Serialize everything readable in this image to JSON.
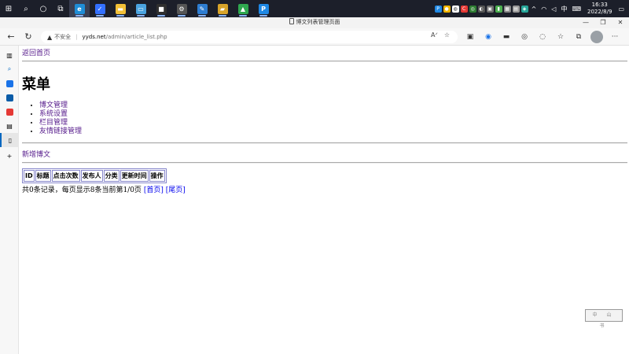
{
  "taskbar": {
    "apps": [
      {
        "name": "edge",
        "color": "#1f8dd6",
        "glyph": "e",
        "active": true
      },
      {
        "name": "feishu",
        "color": "#3370ff",
        "glyph": "✓",
        "active": false
      },
      {
        "name": "explorer",
        "color": "#f2c037",
        "glyph": "▬",
        "active": false
      },
      {
        "name": "monitor",
        "color": "#4aa3df",
        "glyph": "▭",
        "active": false
      },
      {
        "name": "app-dark",
        "color": "#2f2f2f",
        "glyph": "■",
        "active": false
      },
      {
        "name": "settings",
        "color": "#555555",
        "glyph": "⚙",
        "active": false
      },
      {
        "name": "editor",
        "color": "#2e7dd1",
        "glyph": "✎",
        "active": false
      },
      {
        "name": "folder",
        "color": "#d8a42a",
        "glyph": "▰",
        "active": false
      },
      {
        "name": "image",
        "color": "#2fa84f",
        "glyph": "▲",
        "active": false
      },
      {
        "name": "p-app",
        "color": "#1e88e5",
        "glyph": "P",
        "active": false
      }
    ],
    "tray_input": "中",
    "clock_time": "16:33",
    "clock_date": "2022/8/9"
  },
  "window": {
    "tab_title": "博文列表管理页面"
  },
  "address_bar": {
    "security_label": "不安全",
    "host": "yyds.net",
    "path": "/admin/article_list.php"
  },
  "page": {
    "back_home": "返回首页",
    "heading": "菜单",
    "menu": [
      "博文管理",
      "系统设置",
      "栏目管理",
      "友情链接管理"
    ],
    "new_post": "新增博文",
    "table_headers": [
      "ID",
      "标题",
      "点击次数",
      "发布人",
      "分类",
      "更新时间",
      "操作"
    ],
    "pager_text": "共0条记录，每页显示8条当前第1/0页",
    "first_page": "[首页]",
    "last_page": "[尾页]"
  },
  "stamp_text": "中 山 书"
}
